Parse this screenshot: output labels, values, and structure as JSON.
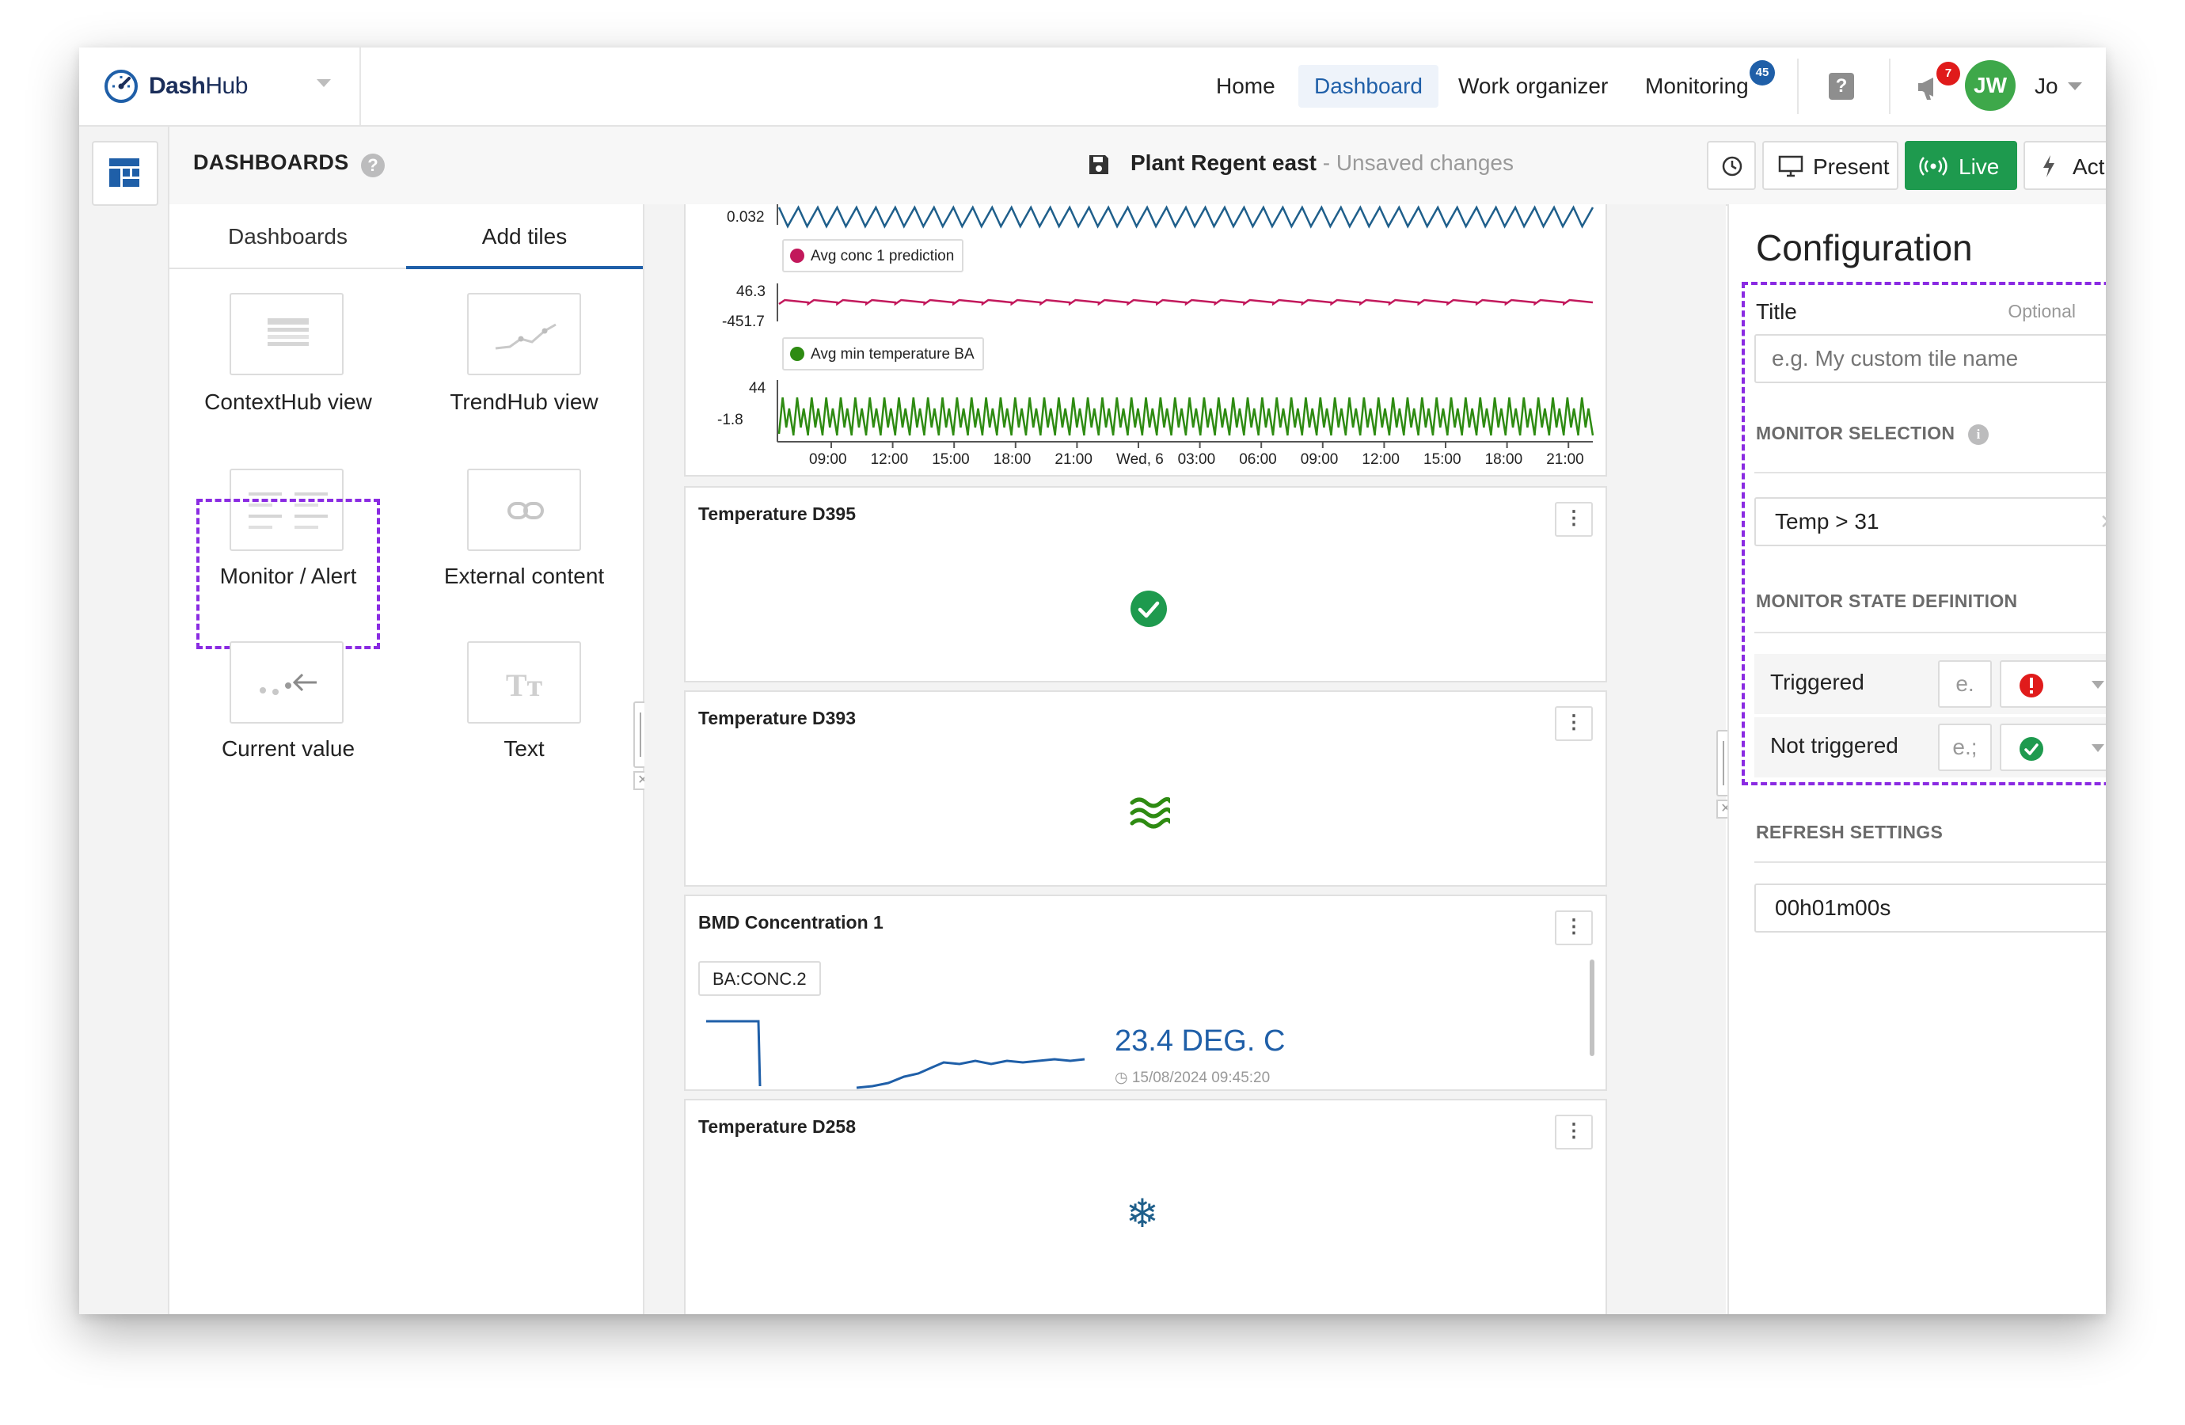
{
  "app": {
    "logo_bold": "Dash",
    "logo_rest": "Hub"
  },
  "nav": {
    "home": "Home",
    "dashboard": "Dashboard",
    "work_organizer": "Work organizer",
    "monitoring": "Monitoring",
    "monitoring_badge": "45",
    "alerts_badge": "7",
    "user_initials": "JW",
    "user_name": "Jo"
  },
  "toolbar": {
    "section_title": "DASHBOARDS",
    "help": "?",
    "dashboard_name": "Plant Regent east",
    "unsaved": "- Unsaved changes",
    "present": "Present",
    "live": "Live",
    "actions": "Actions"
  },
  "left_panel": {
    "tabs": [
      "Dashboards",
      "Add tiles"
    ],
    "active_tab": "Add tiles",
    "tiles": [
      {
        "label": "ContextHub view"
      },
      {
        "label": "TrendHub view"
      },
      {
        "label": "Monitor / Alert"
      },
      {
        "label": "External content"
      },
      {
        "label": "Current value"
      },
      {
        "label": "Text"
      }
    ]
  },
  "trend_tile": {
    "top_label_partial": "0.032",
    "series": [
      {
        "name": "Avg conc 1 prediction",
        "color": "#c2185b",
        "axis_labels": [
          "46.3",
          "-451.7"
        ]
      },
      {
        "name": "Avg min temperature BA",
        "color": "#2e8b12",
        "axis_labels": [
          "44",
          "-1.8"
        ]
      }
    ],
    "top_series_color": "#1f5f8b",
    "time_ticks": [
      "09:00",
      "12:00",
      "15:00",
      "18:00",
      "21:00",
      "Wed, 6",
      "03:00",
      "06:00",
      "09:00",
      "12:00",
      "15:00",
      "18:00",
      "21:00"
    ]
  },
  "tiles": [
    {
      "title": "Temperature D395",
      "state_icon": "check-circle-icon",
      "color": "#1e9a4e"
    },
    {
      "title": "Temperature D393",
      "state_icon": "waves-icon",
      "color": "#2e8b12"
    },
    {
      "title": "BMD Concentration 1",
      "tag": "BA:CONC.2",
      "value": "23.4 DEG. C",
      "timestamp": "15/08/2024 09:45:20",
      "color": "#1f5fa8"
    },
    {
      "title": "Temperature D258",
      "state_icon": "snowflake-icon",
      "color": "#1f5f8b"
    }
  ],
  "config": {
    "heading": "Configuration",
    "title_label": "Title",
    "title_optional": "Optional",
    "title_placeholder": "e.g. My custom tile name",
    "monitor_selection_label": "MONITOR SELECTION",
    "monitor_selection_value": "Temp > 31",
    "state_definition_label": "MONITOR STATE DEFINITION",
    "states": [
      {
        "name": "Triggered",
        "input_placeholder": "e.",
        "icon": "exclamation-circle-icon",
        "color": "#e01b1b"
      },
      {
        "name": "Not triggered",
        "input_placeholder": "e.;",
        "icon": "check-circle-icon",
        "color": "#1e9a4e"
      }
    ],
    "refresh_label": "REFRESH SETTINGS",
    "refresh_value": "00h01m00s"
  },
  "colors": {
    "accent": "#1f5fa8",
    "live": "#1e9a4e",
    "highlight": "#8a2be2"
  }
}
